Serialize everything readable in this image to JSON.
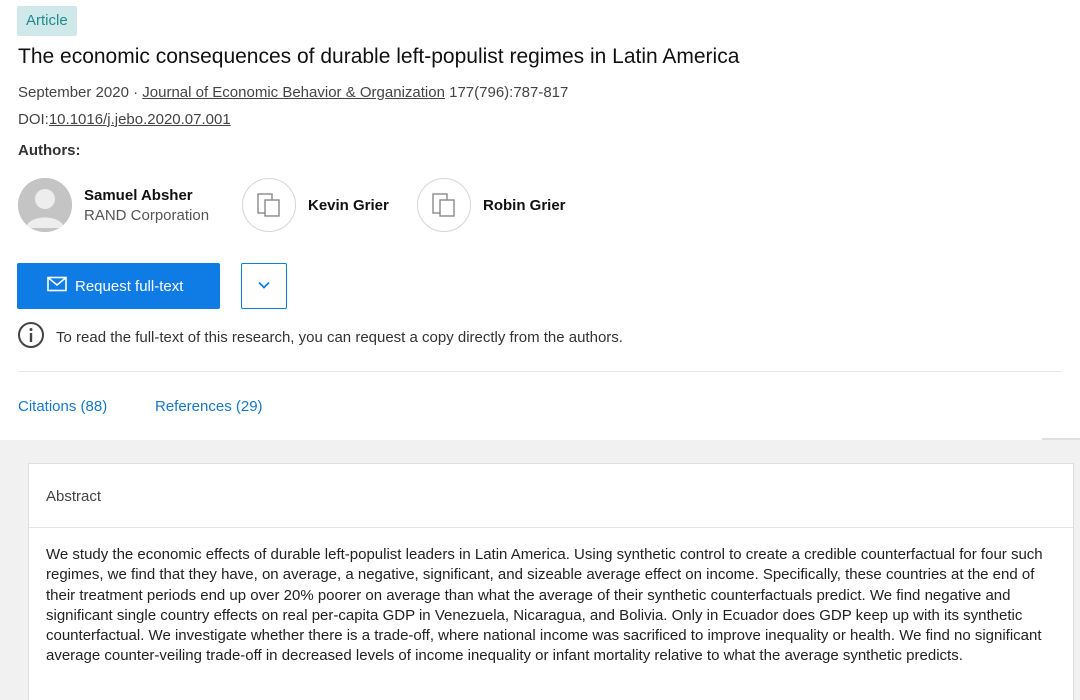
{
  "badge": "Article",
  "title": "The economic consequences of durable left-populist regimes in Latin America",
  "meta": {
    "date": "September 2020",
    "separator": "·",
    "journal": "Journal of Economic Behavior & Organization",
    "pages": "177(796):787-817"
  },
  "doi": {
    "prefix": "DOI:",
    "value": "10.1016/j.jebo.2020.07.001"
  },
  "authors_label": "Authors:",
  "authors": [
    {
      "name": "Samuel Absher",
      "affiliation": "RAND Corporation",
      "icon": "avatar-icon"
    },
    {
      "name": "Kevin Grier",
      "icon": "no-photo-icon"
    },
    {
      "name": "Robin Grier",
      "icon": "no-photo-icon"
    }
  ],
  "actions": {
    "request_label": "Request full-text",
    "request_icon": "envelope-icon",
    "more_icon": "chevron-down-icon"
  },
  "info": {
    "icon": "info-icon",
    "text": "To read the full-text of this research, you can request a copy directly from the authors."
  },
  "tabs": [
    {
      "label": "Citations (88)"
    },
    {
      "label": "References (29)"
    }
  ],
  "abstract": {
    "heading": "Abstract",
    "text": "We study the economic effects of durable left-populist leaders in Latin America. Using synthetic control to create a credible counterfactual for four such regimes, we find that they have, on average, a negative, significant, and sizeable average effect on income. Specifically, these countries at the end of their treatment periods end up over 20% poorer on average than what the average of their synthetic counterfactuals predict. We find negative and significant single country effects on real per-capita GDP in Venezuela, Nicaragua, and Bolivia. Only in Ecuador does GDP keep up with its synthetic counterfactual. We investigate whether there is a trade-off, where national income was sacrificed to improve inequality or health. We find no significant average counter-veiling trade-off in decreased levels of income inequality or infant mortality relative to what the average synthetic predicts."
  },
  "colors": {
    "accent": "#0f7ce6",
    "link": "#1678c9",
    "badge_bg": "#cfe9ea",
    "badge_text": "#1e8a8f",
    "page_bg": "#f1f1f1"
  }
}
